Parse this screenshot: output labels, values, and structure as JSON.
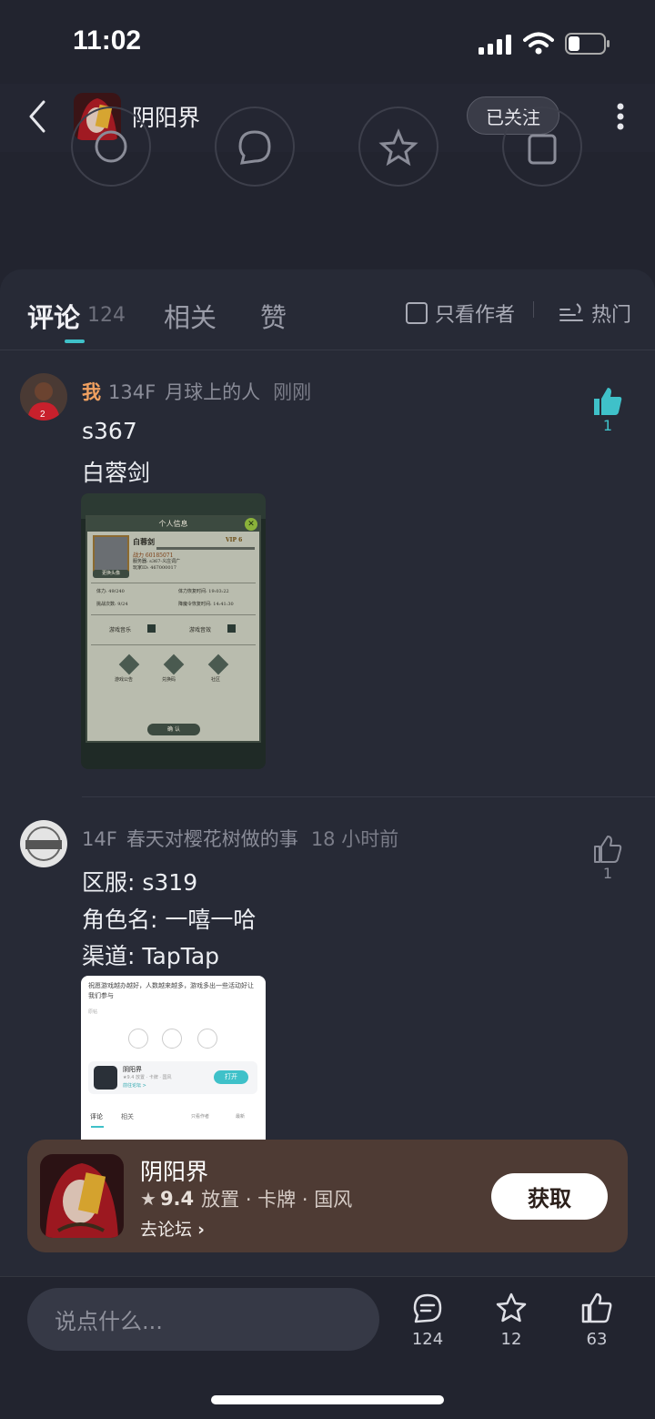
{
  "status": {
    "time": "11:02"
  },
  "header": {
    "title": "阴阳界",
    "follow_label": "已关注"
  },
  "tabs": [
    {
      "label": "评论",
      "count": "124"
    },
    {
      "label": "相关"
    },
    {
      "label": "赞"
    }
  ],
  "filters": {
    "only_author": "只看作者",
    "sort": "热门"
  },
  "comments": [
    {
      "me": "我",
      "floor": "134F",
      "user": "月球上的人",
      "time": "刚刚",
      "lines": [
        "s367",
        "白蓉剑"
      ],
      "likes": "1",
      "liked": true,
      "image": {
        "title": "个人信息",
        "name": "白蓉剑",
        "vip": "VIP 6",
        "power": "战力 60185071",
        "server": "服务器: s367-义庄词广",
        "player_id": "玩家ID: 467000017",
        "change_avatar": "更换头像",
        "stamina": "体力: 49/240",
        "challenges": "挑战次数: 9/24",
        "stamina_time": "体力恢复时间: 19:03:22",
        "challenge_time": "降魔令恢复时间: 14:41:30",
        "music": "游戏音乐",
        "sound": "游戏音效",
        "btn1": "游戏公告",
        "btn2": "兑换码",
        "btn3": "社区",
        "confirm": "确 认"
      }
    },
    {
      "floor": "14F",
      "user": "春天对樱花树做的事",
      "time": "18 小时前",
      "lines": [
        "区服: s319",
        "角色名: 一嘻一哈",
        "渠道: TapTap"
      ],
      "likes": "1",
      "liked": false,
      "image": {
        "text": "祝愿游戏越办越好，人数越来越多，游戏多出一些活动好让我们参与",
        "sub": "原帖",
        "app_name": "阴阳界",
        "app_meta": "★9.4 放置 · 卡牌 · 国风",
        "app_link": "前往论坛 >",
        "open": "打开",
        "tab1": "评论",
        "tab2": "相关",
        "only_author": "只看作者",
        "latest": "最新"
      }
    }
  ],
  "game_card": {
    "name": "阴阳界",
    "rating": "9.4",
    "tags": "放置 · 卡牌 · 国风",
    "link": "去论坛",
    "get_label": "获取"
  },
  "bottom_bar": {
    "placeholder": "说点什么...",
    "comments": "124",
    "favorites": "12",
    "likes": "63"
  },
  "colors": {
    "accent": "#3fc1c9",
    "me": "#f0a060",
    "card_bg": "#4e3b34"
  }
}
